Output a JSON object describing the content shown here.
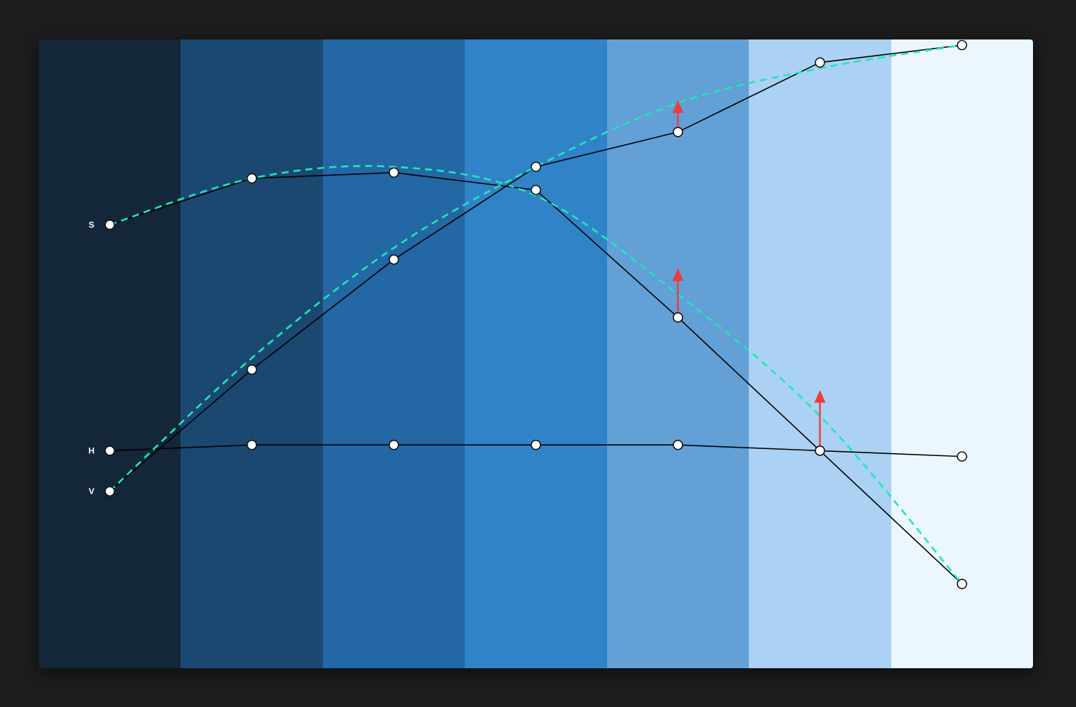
{
  "palette": {
    "swatches": [
      "#13263a",
      "#1b4870",
      "#2367a4",
      "#3183c8",
      "#63a0d6",
      "#abd1f4",
      "#ecf6ff"
    ]
  },
  "curves": [
    {
      "label": "H",
      "actual": [
        0.3,
        0.31,
        0.31,
        0.31,
        0.31,
        0.3,
        0.29
      ]
    },
    {
      "label": "S",
      "actual": [
        0.69,
        0.77,
        0.78,
        0.75,
        0.53,
        0.3,
        0.07
      ],
      "target": [
        0.69,
        0.77,
        0.79,
        0.74,
        0.57,
        0.36,
        0.07
      ],
      "adjust": [
        null,
        null,
        null,
        null,
        0.61,
        0.4,
        null
      ]
    },
    {
      "label": "V",
      "actual": [
        0.23,
        0.44,
        0.63,
        0.79,
        0.85,
        0.97,
        1.0
      ],
      "target": [
        0.23,
        0.46,
        0.65,
        0.79,
        0.9,
        0.96,
        1.0
      ],
      "adjust": [
        null,
        null,
        null,
        null,
        0.9,
        null,
        null
      ]
    }
  ],
  "colors": {
    "actual_line": "#000000",
    "target_line": "#1de9b6",
    "adjust_arrow": "#ef3b3b",
    "point_fill": "#ffffff",
    "point_stroke": "#111111"
  }
}
